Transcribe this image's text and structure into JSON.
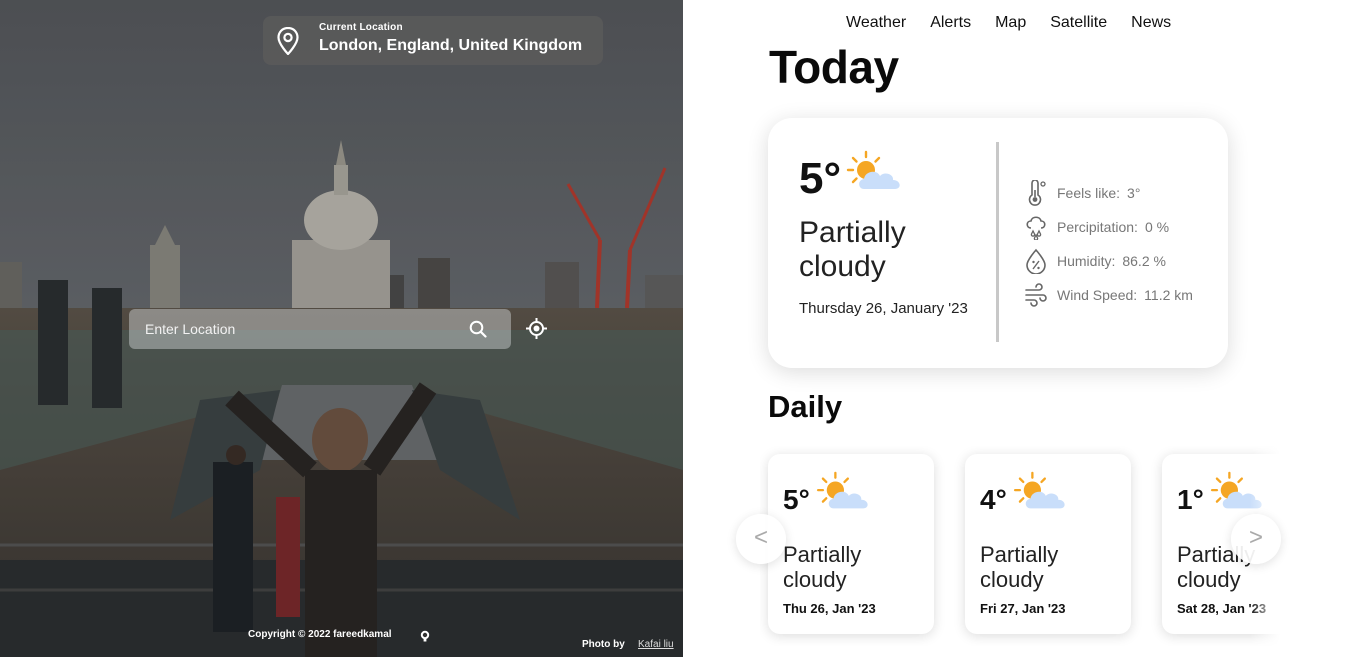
{
  "location": {
    "caption": "Current Location",
    "name": "London, England, United Kingdom"
  },
  "search": {
    "placeholder": "Enter Location",
    "value": ""
  },
  "footer": {
    "copyright": "Copyright © 2022 fareedkamal",
    "photo_by_label": "Photo by",
    "photo_author": "Kafai liu"
  },
  "nav": {
    "items": [
      "Weather",
      "Alerts",
      "Map",
      "Satellite",
      "News"
    ]
  },
  "today": {
    "title": "Today",
    "temp": "5°",
    "condition": "Partially cloudy",
    "date": "Thursday 26, January '23",
    "icon": "partly-cloudy-icon",
    "stats": [
      {
        "icon": "thermometer-icon",
        "label": "Feels like:",
        "value": "3°"
      },
      {
        "icon": "rain-drops-icon",
        "label": "Percipitation:",
        "value": "0 %"
      },
      {
        "icon": "humidity-icon",
        "label": "Humidity:",
        "value": "86.2 %"
      },
      {
        "icon": "wind-icon",
        "label": "Wind Speed:",
        "value": "11.2 km"
      }
    ]
  },
  "daily": {
    "title": "Daily",
    "prev_label": "<",
    "next_label": ">",
    "days": [
      {
        "temp": "5°",
        "condition": "Partially cloudy",
        "date": "Thu 26, Jan '23",
        "icon": "partly-cloudy-icon"
      },
      {
        "temp": "4°",
        "condition": "Partially cloudy",
        "date": "Fri 27, Jan '23",
        "icon": "partly-cloudy-icon"
      },
      {
        "temp": "1°",
        "condition": "Partially cloudy",
        "date": "Sat 28, Jan '23",
        "icon": "partly-cloudy-icon"
      }
    ]
  },
  "colors": {
    "sun": "#f5a623",
    "cloud": "#c9defa",
    "text": "#111111",
    "muted": "#777777"
  }
}
